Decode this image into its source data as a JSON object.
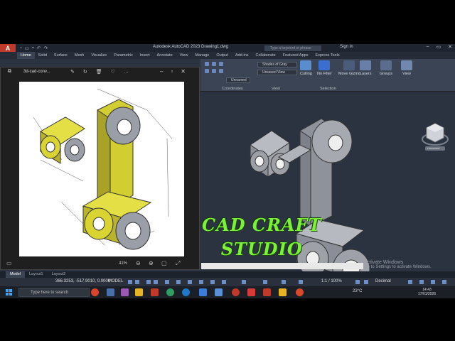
{
  "app": {
    "logo_letter": "A",
    "window_title": "Autodesk AutoCAD 2023  Drawing1.dwg",
    "search_placeholder": "Type a keyword or phrase",
    "signin": "Sign In"
  },
  "ribbon_tabs": [
    "Home",
    "Solid",
    "Surface",
    "Mesh",
    "Visualize",
    "Parametric",
    "Insert",
    "Annotate",
    "View",
    "Manage",
    "Output",
    "Add-ins",
    "Collaborate",
    "Featured Apps",
    "Express Tools"
  ],
  "ribbon": {
    "visual_style": "Shades of Gray",
    "view_name": "Unsaved View",
    "ucs_name": "Unnamed",
    "culling": "Culling",
    "no_filter": "No Filter",
    "move_gizmo": "Move Gizmo",
    "layers": "Layers",
    "groups": "Groups",
    "view_btn": "View",
    "panel_coordinates": "Coordinates",
    "panel_view": "View",
    "panel_selection": "Selection"
  },
  "viewer": {
    "filename": "3d-cad-conv...",
    "zoom": "41%"
  },
  "viewport": {
    "viewcube_label": "Unnamed"
  },
  "watermark": {
    "line1": "CAD CRAFT",
    "line2": "STUDIO"
  },
  "activate": {
    "line1": "Activate Windows",
    "line2": "Go to Settings to activate Windows."
  },
  "layout_tabs": [
    "Model",
    "Layout1",
    "Layout2"
  ],
  "status": {
    "coords": "366.3253, -517.9010, 0.0000",
    "model": "MODEL",
    "scale": "1:1 / 100%",
    "units": "Decimal"
  },
  "taskbar": {
    "search_placeholder": "Type here to search",
    "weather": "23°C",
    "time": "14:43",
    "date": "17/01/2026"
  },
  "colors": {
    "acad_red": "#c0392b",
    "ribbon_bg": "#3b4454",
    "model_yellow": "#d9d432",
    "model_gray": "#9a9ea6",
    "watermark_green": "#7ef03a"
  }
}
